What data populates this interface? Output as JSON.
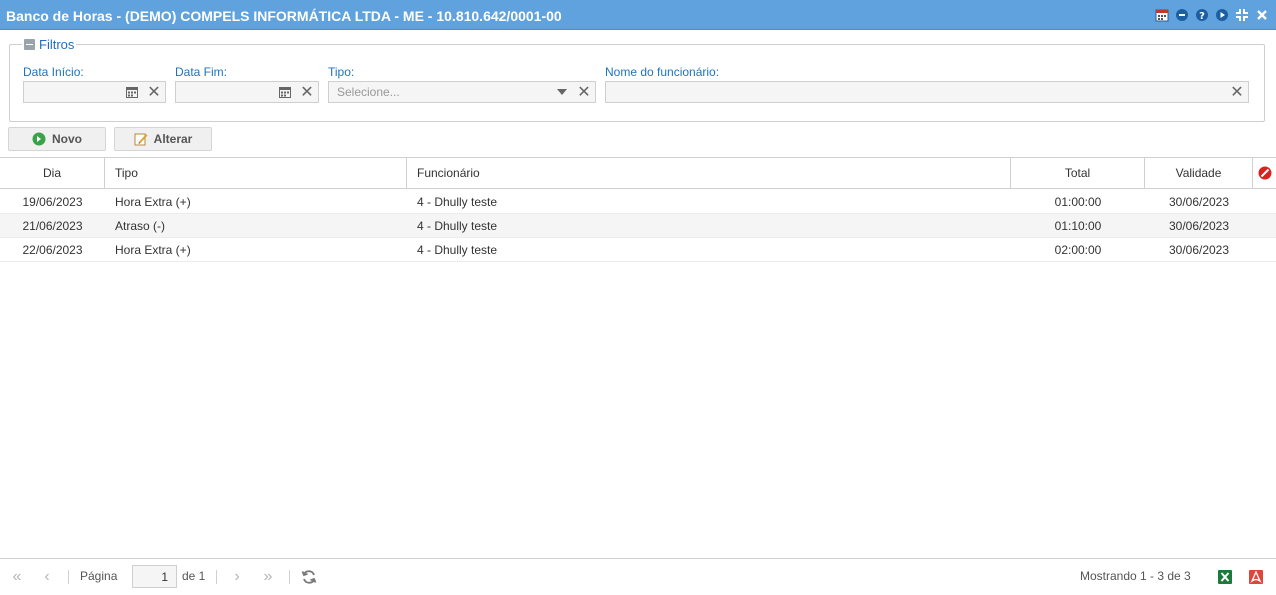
{
  "window": {
    "title": "Banco de Horas - (DEMO) COMPELS INFORMÁTICA LTDA - ME - 10.810.642/0001-00",
    "tools": [
      "calendar-icon",
      "minimize-icon",
      "help-icon",
      "play-icon",
      "restore-icon",
      "close-icon"
    ]
  },
  "filters": {
    "legend": "Filtros",
    "data_inicio": {
      "label": "Data Início:",
      "value": ""
    },
    "data_fim": {
      "label": "Data Fim:",
      "value": ""
    },
    "tipo": {
      "label": "Tipo:",
      "placeholder": "Selecione...",
      "value": ""
    },
    "funcionario": {
      "label": "Nome do funcionário:",
      "value": ""
    }
  },
  "toolbar": {
    "novo_label": "Novo",
    "alterar_label": "Alterar"
  },
  "grid": {
    "columns": [
      "Dia",
      "Tipo",
      "Funcionário",
      "Total",
      "Validade"
    ],
    "rows": [
      {
        "dia": "19/06/2023",
        "tipo": "Hora Extra (+)",
        "funcionario": "4 - Dhully teste",
        "total": "01:00:00",
        "validade": "30/06/2023"
      },
      {
        "dia": "21/06/2023",
        "tipo": "Atraso (-)",
        "funcionario": "4 - Dhully teste",
        "total": "01:10:00",
        "validade": "30/06/2023"
      },
      {
        "dia": "22/06/2023",
        "tipo": "Hora Extra (+)",
        "funcionario": "4 - Dhully teste",
        "total": "02:00:00",
        "validade": "30/06/2023"
      }
    ]
  },
  "paging": {
    "page_label": "Página",
    "page_value": "1",
    "of_label": "de 1",
    "display_msg": "Mostrando 1 - 3 de 3"
  },
  "colors": {
    "titlebar": "#5fa2dd",
    "label_blue": "#1e73be",
    "excel_green": "#1d7a3a",
    "pdf_red": "#e0453a",
    "add_green": "#3aa34a",
    "clear_filter_red": "#d9211e"
  }
}
